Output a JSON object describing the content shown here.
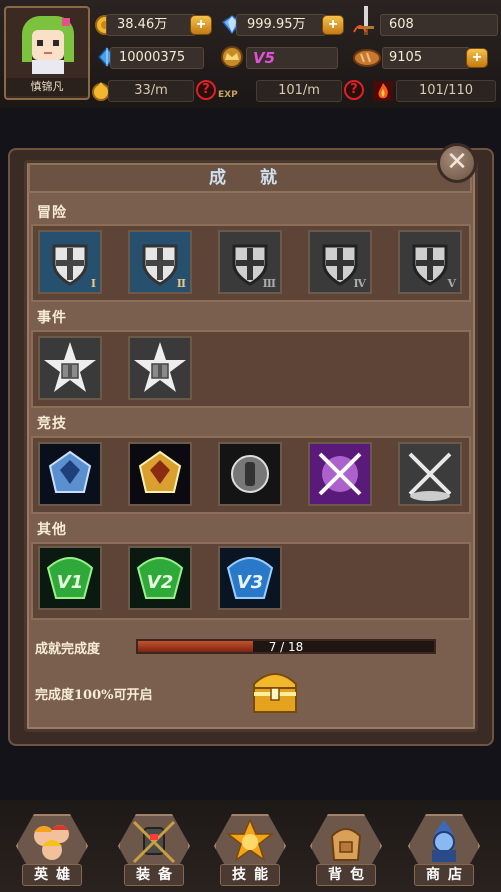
{
  "player": {
    "name": "慎锦凡"
  },
  "resources": {
    "gold": "38.46万",
    "diamonds": "999.95万",
    "sword_power": "608",
    "crystals": "10000375",
    "vip": "V5",
    "food": "9105",
    "gold_rate": "33/m",
    "exp_rate": "101/m",
    "stamina": "101/110",
    "exp_label": "EXP"
  },
  "panel": {
    "title": "成 就",
    "close_symbol": "✕",
    "sections": [
      {
        "label": "冒险",
        "badges": [
          "Ⅰ",
          "Ⅱ",
          "Ⅲ",
          "Ⅳ",
          "Ⅴ"
        ]
      },
      {
        "label": "事件",
        "badges": [
          "star-gift",
          "star-gift"
        ]
      },
      {
        "label": "竞技",
        "badges": [
          "blue-crest",
          "gold-crest",
          "silver-crest",
          "purple-swords",
          "grey-swords"
        ]
      },
      {
        "label": "其他",
        "badges": [
          "V1",
          "V2",
          "V3"
        ]
      }
    ],
    "completion_label": "成就完成度",
    "completion_text": "7 / 18",
    "completion_fraction": 0.3889,
    "unlock_label": "完成度100%可开启"
  },
  "nav": {
    "items": [
      {
        "label": "英雄",
        "icon": "heroes-icon"
      },
      {
        "label": "装备",
        "icon": "equipment-icon"
      },
      {
        "label": "技能",
        "icon": "skills-icon"
      },
      {
        "label": "背包",
        "icon": "backpack-icon"
      },
      {
        "label": "商店",
        "icon": "shop-icon"
      }
    ]
  },
  "colors": {
    "panel_bg": "#7b5f4e",
    "title_text": "#cfe0f0",
    "progress_fill": "#c2532b",
    "plus_button": "#f5c24c"
  }
}
